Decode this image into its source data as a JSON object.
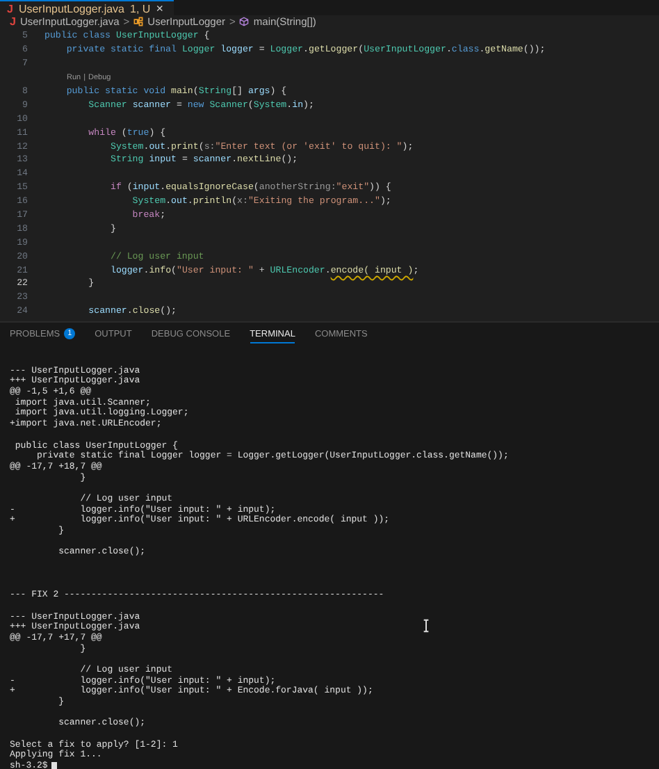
{
  "editor_tab": {
    "icon_letter": "J",
    "title": "UserInputLogger.java",
    "status": "1, U",
    "close": "×",
    "selected": true
  },
  "breadcrumb": [
    {
      "kind": "file",
      "icon_letter": "J",
      "label": "UserInputLogger.java"
    },
    {
      "kind": "class",
      "label": "UserInputLogger"
    },
    {
      "kind": "method",
      "label": "main(String[])"
    }
  ],
  "breadcrumb_separator": ">",
  "code_lines": [
    {
      "number": "5",
      "current": false,
      "tokens": [
        {
          "kind": "kw",
          "text": "public class "
        },
        {
          "kind": "type",
          "text": "UserInputLogger"
        },
        {
          "kind": "plain",
          "text": " {"
        }
      ]
    },
    {
      "number": "6",
      "current": false,
      "tokens": [
        {
          "kind": "kw",
          "text": "    private static final "
        },
        {
          "kind": "type",
          "text": "Logger"
        },
        {
          "kind": "var",
          "text": " logger"
        },
        {
          "kind": "plain",
          "text": " = "
        },
        {
          "kind": "type",
          "text": "Logger"
        },
        {
          "kind": "plain",
          "text": "."
        },
        {
          "kind": "fn",
          "text": "getLogger"
        },
        {
          "kind": "plain",
          "text": "("
        },
        {
          "kind": "type",
          "text": "UserInputLogger"
        },
        {
          "kind": "plain",
          "text": "."
        },
        {
          "kind": "kw",
          "text": "class"
        },
        {
          "kind": "plain",
          "text": "."
        },
        {
          "kind": "fn",
          "text": "getName"
        },
        {
          "kind": "plain",
          "text": "());"
        }
      ]
    },
    {
      "number": "7",
      "current": false
    },
    {
      "number": "8",
      "current": false,
      "codelens": {
        "items": [
          "Run",
          "Debug"
        ],
        "separator": "|"
      },
      "tokens": [
        {
          "kind": "kw",
          "text": "    public static void "
        },
        {
          "kind": "fn",
          "text": "main"
        },
        {
          "kind": "plain",
          "text": "("
        },
        {
          "kind": "type",
          "text": "String"
        },
        {
          "kind": "plain",
          "text": "[] "
        },
        {
          "kind": "var",
          "text": "args"
        },
        {
          "kind": "plain",
          "text": ") {"
        }
      ]
    },
    {
      "number": "9",
      "current": false,
      "tokens": [
        {
          "kind": "type",
          "text": "        Scanner"
        },
        {
          "kind": "var",
          "text": " scanner"
        },
        {
          "kind": "plain",
          "text": " = "
        },
        {
          "kind": "kw",
          "text": "new "
        },
        {
          "kind": "type",
          "text": "Scanner"
        },
        {
          "kind": "plain",
          "text": "("
        },
        {
          "kind": "type",
          "text": "System"
        },
        {
          "kind": "plain",
          "text": "."
        },
        {
          "kind": "var",
          "text": "in"
        },
        {
          "kind": "plain",
          "text": ");"
        }
      ]
    },
    {
      "number": "10",
      "current": false
    },
    {
      "number": "11",
      "current": false,
      "tokens": [
        {
          "kind": "ctrl",
          "text": "        while"
        },
        {
          "kind": "plain",
          "text": " ("
        },
        {
          "kind": "kw",
          "text": "true"
        },
        {
          "kind": "plain",
          "text": ") {"
        }
      ]
    },
    {
      "number": "12",
      "current": false,
      "tokens": [
        {
          "kind": "type",
          "text": "            System"
        },
        {
          "kind": "plain",
          "text": "."
        },
        {
          "kind": "var",
          "text": "out"
        },
        {
          "kind": "plain",
          "text": "."
        },
        {
          "kind": "fn",
          "text": "print"
        },
        {
          "kind": "plain",
          "text": "("
        },
        {
          "kind": "hint",
          "text": "s:"
        },
        {
          "kind": "str",
          "text": "\"Enter text (or 'exit' to quit): \""
        },
        {
          "kind": "plain",
          "text": ");"
        }
      ]
    },
    {
      "number": "13",
      "current": false,
      "tokens": [
        {
          "kind": "type",
          "text": "            String"
        },
        {
          "kind": "var",
          "text": " input"
        },
        {
          "kind": "plain",
          "text": " = "
        },
        {
          "kind": "var",
          "text": "scanner"
        },
        {
          "kind": "plain",
          "text": "."
        },
        {
          "kind": "fn",
          "text": "nextLine"
        },
        {
          "kind": "plain",
          "text": "();"
        }
      ]
    },
    {
      "number": "14",
      "current": false
    },
    {
      "number": "15",
      "current": false,
      "tokens": [
        {
          "kind": "ctrl",
          "text": "            if"
        },
        {
          "kind": "plain",
          "text": " ("
        },
        {
          "kind": "var",
          "text": "input"
        },
        {
          "kind": "plain",
          "text": "."
        },
        {
          "kind": "fn",
          "text": "equalsIgnoreCase"
        },
        {
          "kind": "plain",
          "text": "("
        },
        {
          "kind": "hint",
          "text": "anotherString:"
        },
        {
          "kind": "str",
          "text": "\"exit\""
        },
        {
          "kind": "plain",
          "text": ")) {"
        }
      ]
    },
    {
      "number": "16",
      "current": false,
      "tokens": [
        {
          "kind": "type",
          "text": "                System"
        },
        {
          "kind": "plain",
          "text": "."
        },
        {
          "kind": "var",
          "text": "out"
        },
        {
          "kind": "plain",
          "text": "."
        },
        {
          "kind": "fn",
          "text": "println"
        },
        {
          "kind": "plain",
          "text": "("
        },
        {
          "kind": "hint",
          "text": "x:"
        },
        {
          "kind": "str",
          "text": "\"Exiting the program...\""
        },
        {
          "kind": "plain",
          "text": ");"
        }
      ]
    },
    {
      "number": "17",
      "current": false,
      "tokens": [
        {
          "kind": "ctrl",
          "text": "                break"
        },
        {
          "kind": "plain",
          "text": ";"
        }
      ]
    },
    {
      "number": "18",
      "current": false,
      "tokens": [
        {
          "kind": "plain",
          "text": "            }"
        }
      ]
    },
    {
      "number": "19",
      "current": false
    },
    {
      "number": "20",
      "current": false,
      "tokens": [
        {
          "kind": "comment",
          "text": "            // Log user input"
        }
      ]
    },
    {
      "number": "21",
      "current": false,
      "tokens": [
        {
          "kind": "var",
          "text": "            logger"
        },
        {
          "kind": "plain",
          "text": "."
        },
        {
          "kind": "fn",
          "text": "info"
        },
        {
          "kind": "plain",
          "text": "("
        },
        {
          "kind": "str",
          "text": "\"User input: \""
        },
        {
          "kind": "plain",
          "text": " + "
        },
        {
          "kind": "type",
          "text": "URLEncoder"
        },
        {
          "kind": "plain",
          "text": "."
        },
        {
          "kind": "deprecated",
          "text": "encode( input )"
        },
        {
          "kind": "plain",
          "text": ";"
        }
      ]
    },
    {
      "number": "22",
      "current": true,
      "tokens": [
        {
          "kind": "plain",
          "text": "        }"
        }
      ]
    },
    {
      "number": "23",
      "current": false
    },
    {
      "number": "24",
      "current": false,
      "tokens": [
        {
          "kind": "var",
          "text": "        scanner"
        },
        {
          "kind": "plain",
          "text": "."
        },
        {
          "kind": "fn",
          "text": "close"
        },
        {
          "kind": "plain",
          "text": "();"
        }
      ]
    }
  ],
  "panel_tabs": [
    {
      "label": "PROBLEMS",
      "badge": "1",
      "selected": false
    },
    {
      "label": "OUTPUT",
      "selected": false
    },
    {
      "label": "DEBUG CONSOLE",
      "selected": false
    },
    {
      "label": "TERMINAL",
      "selected": true
    },
    {
      "label": "COMMENTS",
      "selected": false
    }
  ],
  "terminal": {
    "blocks": [
      [
        "--- UserInputLogger.java",
        "+++ UserInputLogger.java",
        "@@ -1,5 +1,6 @@",
        " import java.util.Scanner;",
        " import java.util.logging.Logger;",
        "+import java.net.URLEncoder;"
      ],
      [
        " public class UserInputLogger {",
        "     private static final Logger logger = Logger.getLogger(UserInputLogger.class.getName());",
        "@@ -17,7 +18,7 @@",
        "             }"
      ],
      [
        "             // Log user input",
        "-            logger.info(\"User input: \" + input);",
        "+            logger.info(\"User input: \" + URLEncoder.encode( input ));",
        "         }"
      ],
      [
        "         scanner.close();"
      ],
      [
        "--- FIX 2 -----------------------------------------------------------"
      ],
      [
        "--- UserInputLogger.java",
        "+++ UserInputLogger.java",
        "@@ -17,7 +17,7 @@",
        "             }"
      ],
      [
        "             // Log user input",
        "-            logger.info(\"User input: \" + input);",
        "+            logger.info(\"User input: \" + Encode.forJava( input ));",
        "         }"
      ],
      [
        "         scanner.close();"
      ],
      [
        "Select a fix to apply? [1-2]: 1",
        "Applying fix 1...",
        "sh-3.2$"
      ]
    ],
    "cursor_visible": true
  }
}
